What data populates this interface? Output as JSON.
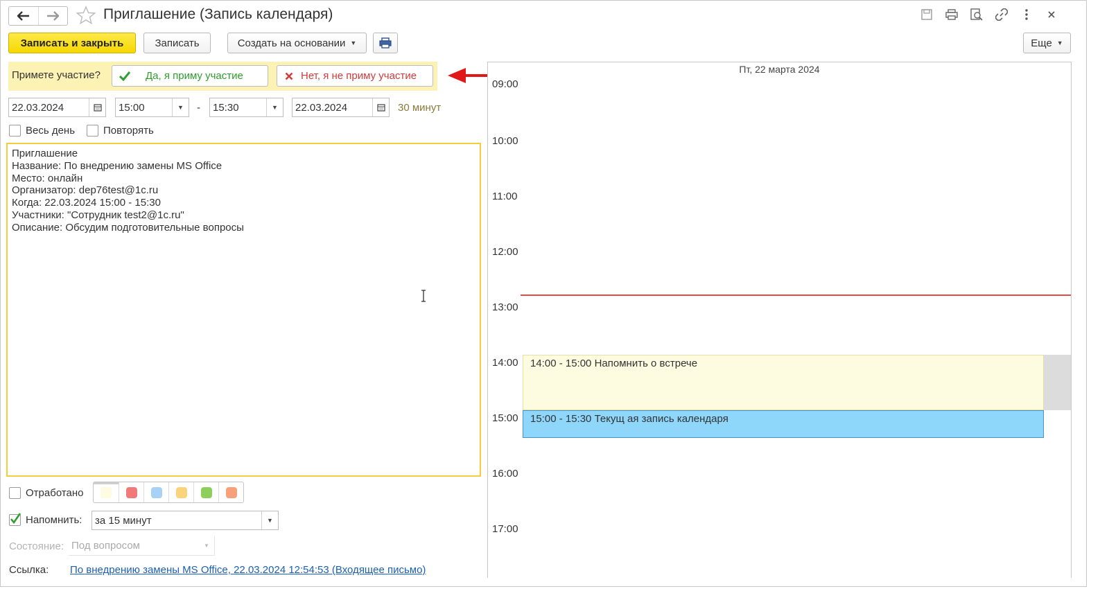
{
  "window": {
    "title": "Приглашение (Запись календаря)",
    "top_icons": [
      "save-icon",
      "print-icon",
      "preview-icon",
      "link-icon",
      "more-vertical-icon",
      "close-icon"
    ]
  },
  "toolbar": {
    "save_close": "Записать и закрыть",
    "save": "Записать",
    "create_based": "Создать на основании",
    "more": "Еще"
  },
  "invite": {
    "question": "Примете участие?",
    "accept": "Да, я приму участие",
    "decline": "Нет, я не приму участие"
  },
  "event": {
    "start_date": "22.03.2024",
    "start_time": "15:00",
    "separator": "-",
    "end_time": "15:30",
    "end_date": "22.03.2024",
    "duration": "30 минут",
    "all_day_label": "Весь день",
    "repeat_label": "Повторять"
  },
  "memo": {
    "lines": [
      "Приглашение",
      "Название: По внедрению замены MS Office",
      "Место: онлайн",
      "Организатор: dep76test@1c.ru",
      "Когда: 22.03.2024 15:00 - 15:30",
      "Участники: \"Сотрудник test2@1c.ru\"",
      "Описание: Обсудим подготовительные вопросы"
    ]
  },
  "bottom": {
    "worked_label": "Отработано",
    "colors": [
      "#fffbe0",
      "#f07a7a",
      "#a8d2f5",
      "#fad47a",
      "#8ccf5a",
      "#f7a07a"
    ],
    "remind_label": "Напомнить:",
    "remind_value": "за 15 минут",
    "status_label": "Состояние:",
    "status_value": "Под вопросом",
    "link_label": "Ссылка:",
    "link_text": "По внедрению замены MS Office, 22.03.2024 12:54:53 (Входящее письмо)"
  },
  "calendar": {
    "day_header": "Пт, 22 марта 2024",
    "hours": [
      "09:00",
      "10:00",
      "11:00",
      "12:00",
      "13:00",
      "14:00",
      "15:00",
      "16:00",
      "17:00"
    ],
    "events": [
      {
        "time": "14:00 - 15:00",
        "title": "Напомнить о встрече",
        "color": "#fdfbe0"
      },
      {
        "time": "15:00 - 15:30",
        "title": "Текущ ая запись календаря",
        "color": "#8fd6fb"
      }
    ]
  },
  "colors": {
    "accent_yellow": "#f6d800",
    "invite_strip": "#fbf2b3",
    "accept_green": "#2e9e2e",
    "decline_red": "#d33b3b",
    "arrow_red": "#e01818",
    "now_line": "#e84a4a"
  }
}
